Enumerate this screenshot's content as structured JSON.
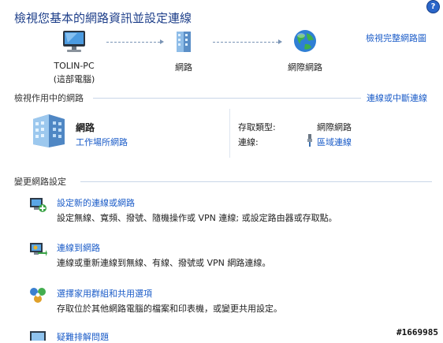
{
  "page": {
    "title": "檢視您基本的網路資訊並設定連線",
    "help_glyph": "?"
  },
  "network_map": {
    "view_full_map": "檢視完整網路圖",
    "nodes": [
      {
        "name": "TOLIN-PC",
        "sub": "(這部電腦)"
      },
      {
        "name": "網路"
      },
      {
        "name": "網際網路"
      }
    ]
  },
  "active": {
    "heading": "檢視作用中的網路",
    "connect_link": "連線或中斷連線",
    "network_name": "網路",
    "network_type": "工作場所網路",
    "access_type_label": "存取類型:",
    "access_type_value": "網際網路",
    "connections_label": "連線:",
    "connections_value": "區域連線"
  },
  "change": {
    "heading": "變更網路設定",
    "tasks": [
      {
        "title": "設定新的連線或網路",
        "desc": "設定無線、寬頻、撥號、隨機操作或 VPN 連線; 或設定路由器或存取點。"
      },
      {
        "title": "連線到網路",
        "desc": "連線或重新連線到無線、有線、撥號或 VPN 網路連線。"
      },
      {
        "title": "選擇家用群組和共用選項",
        "desc": "存取位於其他網路電腦的檔案和印表機，或變更共用設定。"
      },
      {
        "title": "疑難排解問題"
      }
    ]
  },
  "watermark": "#1669985"
}
